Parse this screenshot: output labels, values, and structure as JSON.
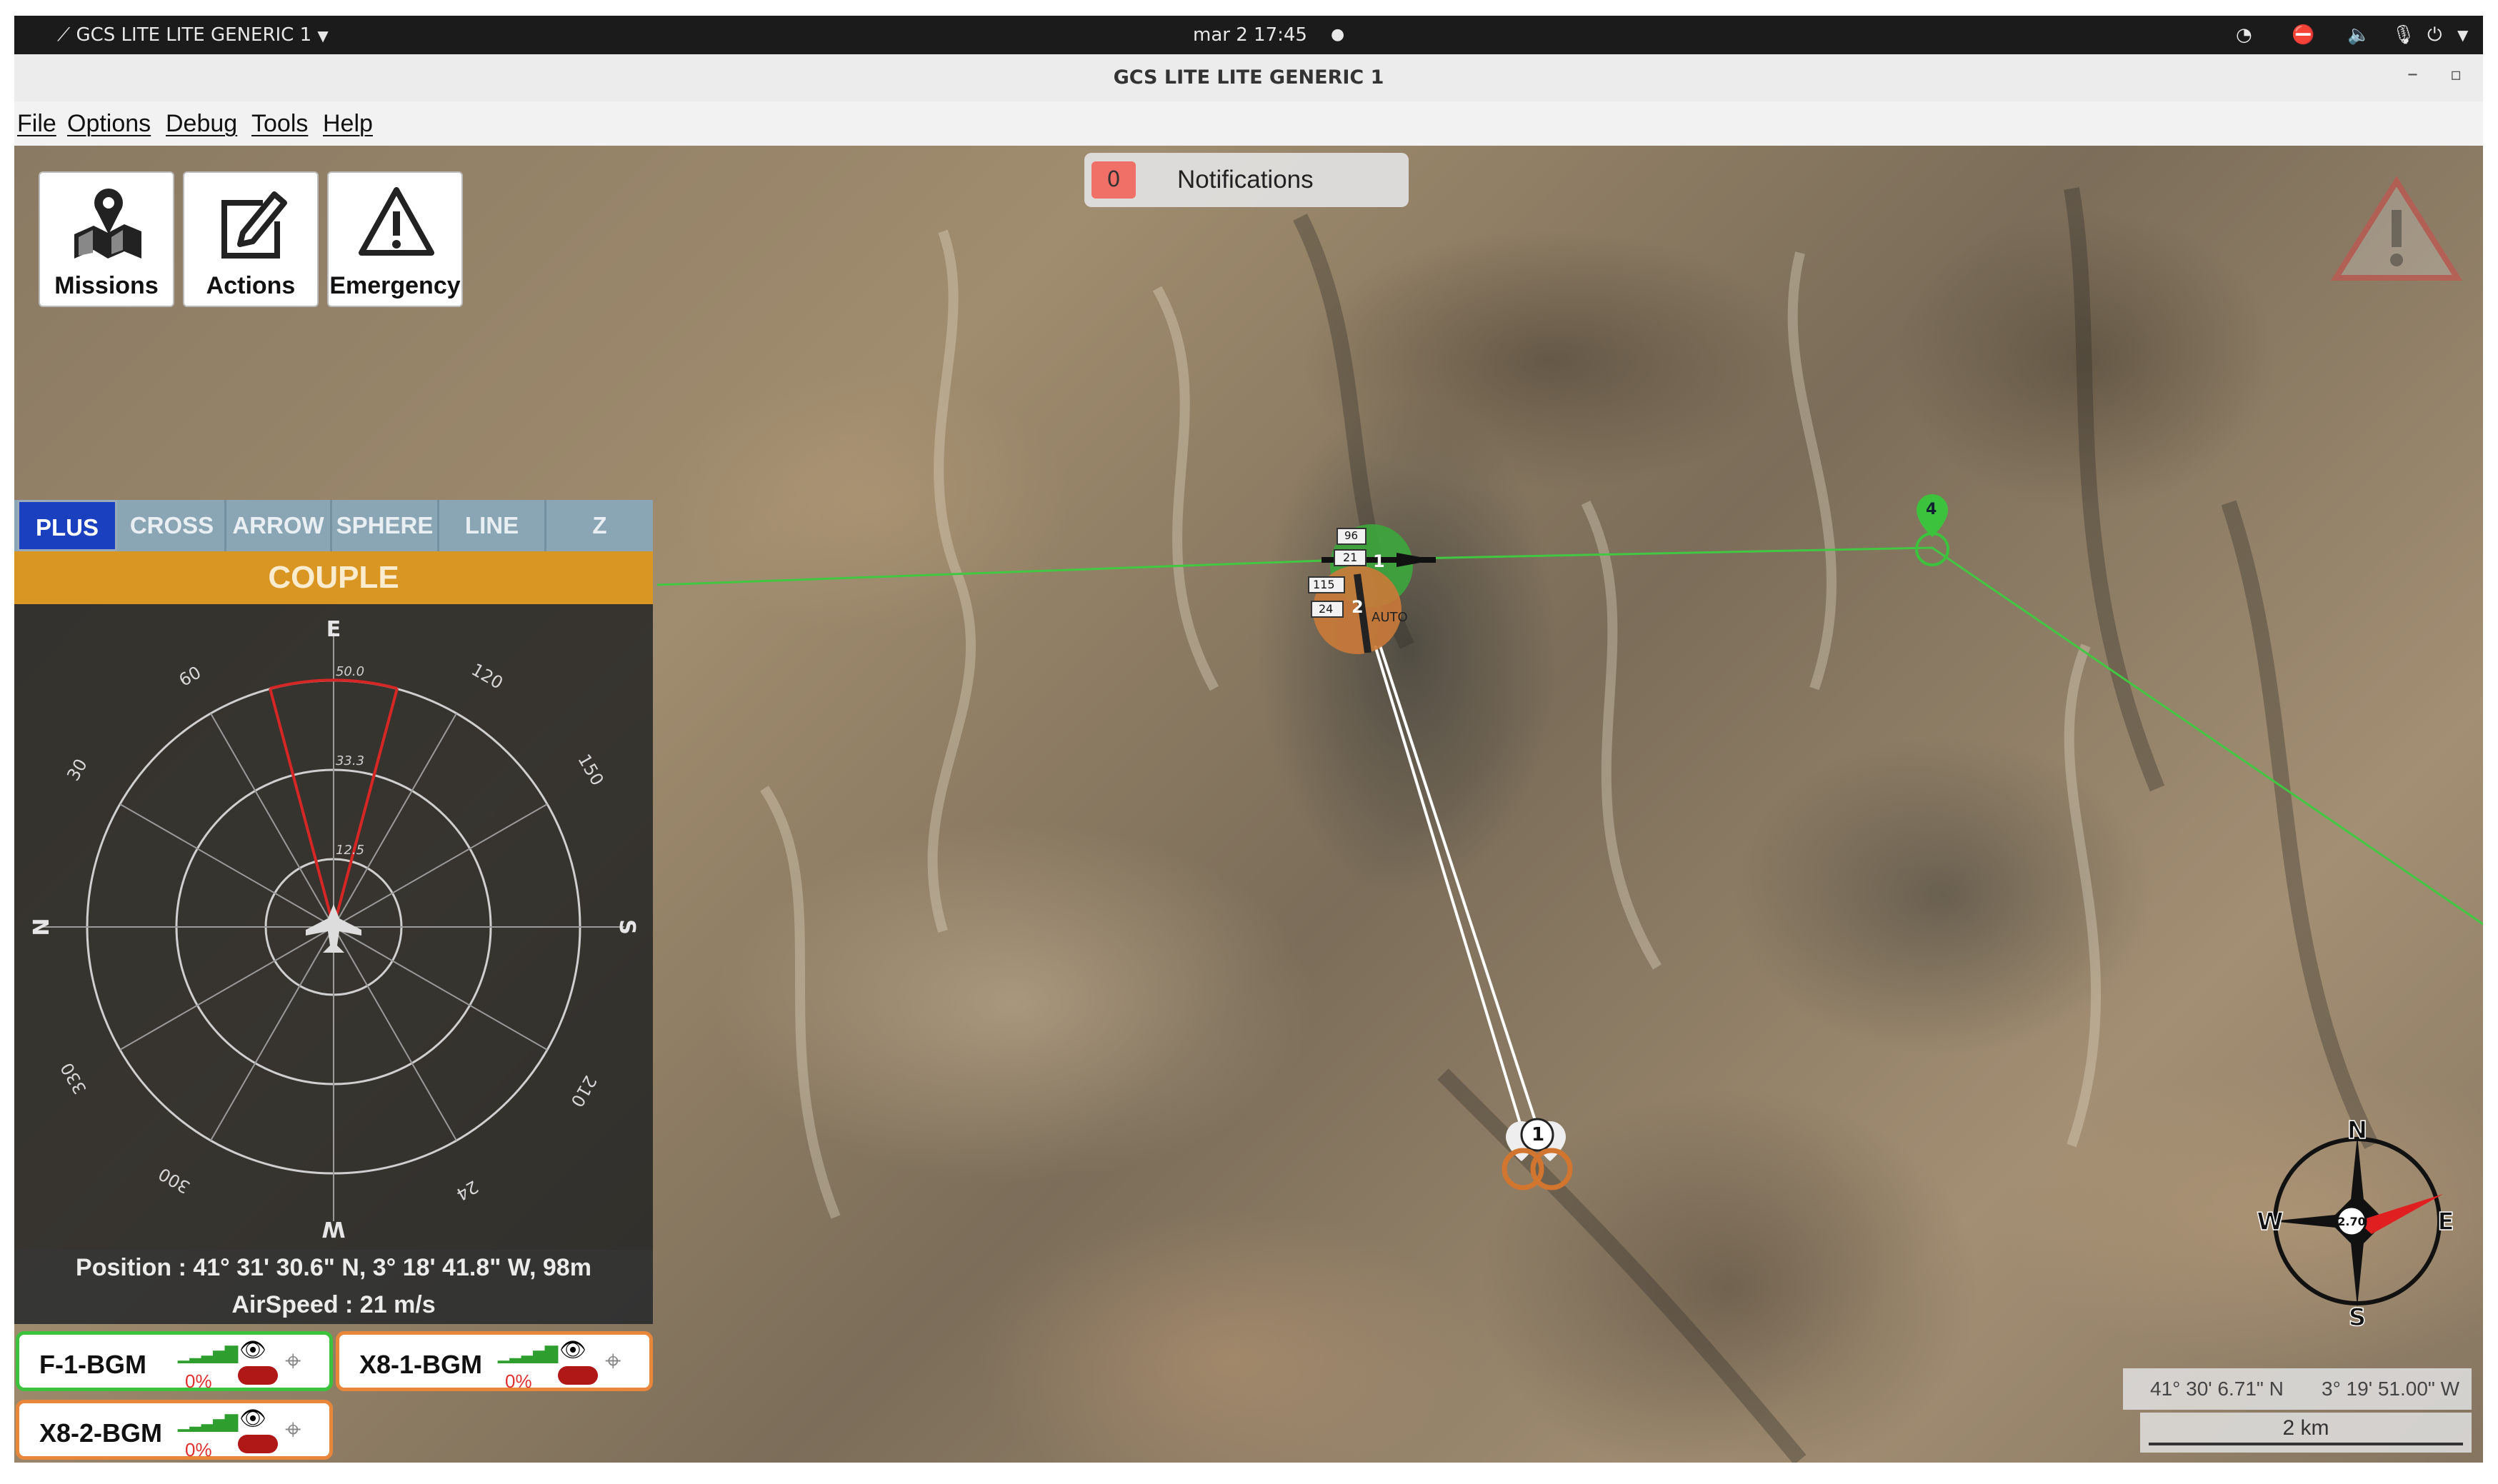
{
  "system_bar": {
    "app_name": "GCS LITE LITE GENERIC 1",
    "datetime": "mar 2  17:45"
  },
  "window": {
    "title": "GCS LITE LITE GENERIC 1"
  },
  "menu": [
    "File",
    "Options",
    "Debug",
    "Tools",
    "Help"
  ],
  "toolbar": {
    "missions": "Missions",
    "actions": "Actions",
    "emergency": "Emergency"
  },
  "notifications": {
    "count": "0",
    "label": "Notifications"
  },
  "view_modes": {
    "items": [
      "PLUS",
      "CROSS",
      "ARROW",
      "SPHERE",
      "LINE",
      "Z"
    ],
    "active": "PLUS"
  },
  "couple_label": "COUPLE",
  "radar": {
    "cardinals": {
      "top": "E",
      "bottom": "W",
      "left": "N",
      "right": "S"
    },
    "bearings": [
      "30",
      "60",
      "120",
      "150",
      "210",
      "24",
      "300",
      "330"
    ],
    "ring_labels": [
      "50.0",
      "33.3",
      "12.5"
    ]
  },
  "status": {
    "position": "Position :  41° 31' 30.6\" N, 3° 18' 41.8\" W, 98m",
    "airspeed": "AirSpeed : 21 m/s"
  },
  "vehicles": [
    {
      "name": "F-1-BGM",
      "battery": "0%",
      "border": "#3cc23c"
    },
    {
      "name": "X8-1-BGM",
      "battery": "0%",
      "border": "#e8873a"
    },
    {
      "name": "X8-2-BGM",
      "battery": "0%",
      "border": "#e8873a"
    }
  ],
  "map_markers": {
    "waypoint_4": "4",
    "vehicle_1": "1",
    "vehicle_2": "2",
    "target": "1",
    "label_96": "96",
    "label_21": "21",
    "label_115": "115",
    "label_24": "24",
    "auto": "AUTO"
  },
  "compass": {
    "n": "N",
    "s": "S",
    "e": "E",
    "w": "W",
    "heading": "2.70"
  },
  "map_coords": {
    "lat": "41° 30' 6.71\" N",
    "lon": "3° 19' 51.00\" W"
  },
  "scale": "2 km",
  "colors": {
    "accent": "#1a3fbf",
    "couple": "#d99622",
    "green": "#3cc23c",
    "orange": "#e8873a",
    "alert": "#e03030"
  }
}
